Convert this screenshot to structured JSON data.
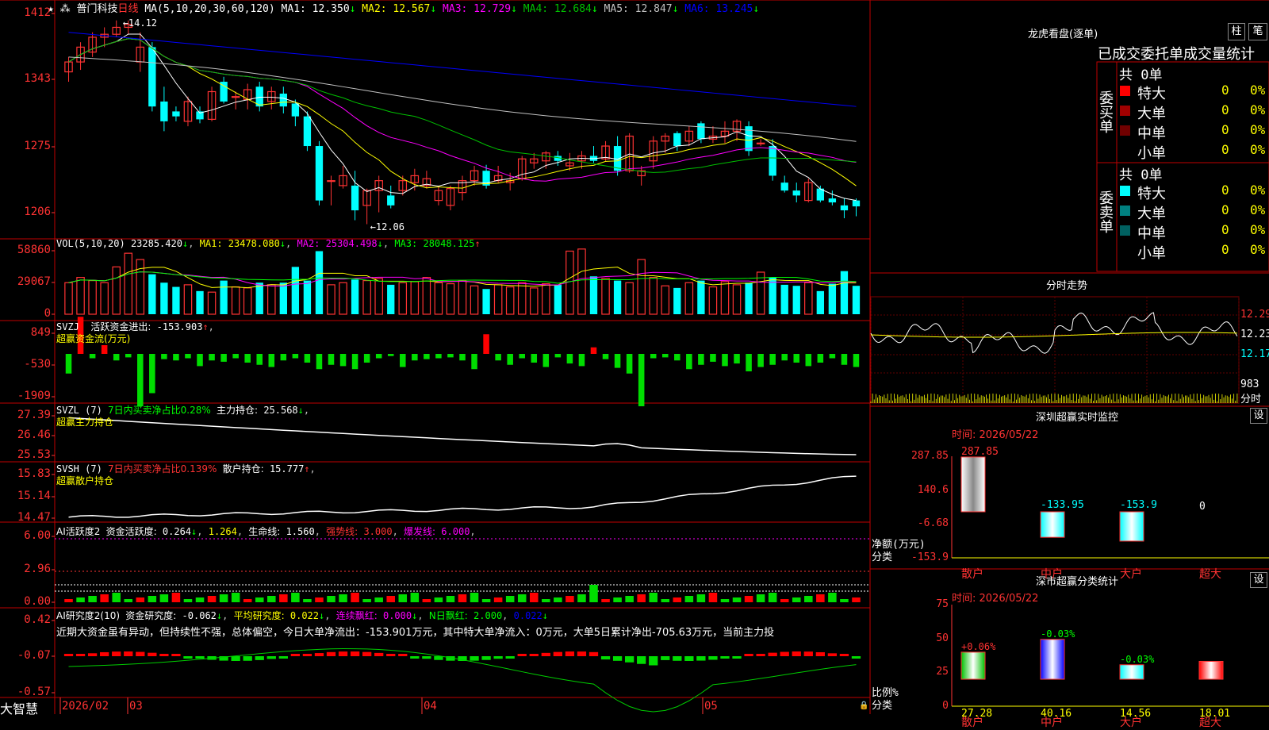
{
  "app": {
    "brand": "大智慧",
    "stock_name": "普门科技",
    "period": "日线"
  },
  "dates": {
    "x_labels": [
      "2026/02",
      "03",
      "04",
      "05"
    ]
  },
  "colors": {
    "up": "#ff3333",
    "down": "#00ffff",
    "grid": "#c00000",
    "ma1": "#ffffff",
    "ma2": "#ffff00",
    "ma3": "#ff00ff",
    "ma4": "#00c000",
    "ma5": "#c0c0c0",
    "ma6": "#0000ff"
  },
  "main_chart": {
    "header": "MA(5,10,20,30,60,120)",
    "ma_values": [
      {
        "label": "MA1:",
        "value": "12.350",
        "arrow": "↓",
        "color": "#ffffff"
      },
      {
        "label": "MA2:",
        "value": "12.567",
        "arrow": "↓",
        "color": "#ffff00"
      },
      {
        "label": "MA3:",
        "value": "12.729",
        "arrow": "↓",
        "color": "#ff00ff"
      },
      {
        "label": "MA4:",
        "value": "12.684",
        "arrow": "↓",
        "color": "#00c000"
      },
      {
        "label": "MA5:",
        "value": "12.847",
        "arrow": "↓",
        "color": "#c0c0c0"
      },
      {
        "label": "MA6:",
        "value": "13.245",
        "arrow": "↓",
        "color": "#0000ff"
      }
    ],
    "y_ticks": [
      "1412",
      "1343",
      "1275",
      "1206"
    ],
    "high_label": "14.12",
    "low_label": "12.06"
  },
  "chart_data": [
    {
      "type": "candlestick",
      "title": "普门科技 日线",
      "ylim": [
        12.0,
        14.15
      ],
      "candles": [
        {
          "o": 13.6,
          "h": 13.75,
          "l": 13.5,
          "c": 13.7
        },
        {
          "o": 13.7,
          "h": 13.9,
          "l": 13.62,
          "c": 13.85
        },
        {
          "o": 13.8,
          "h": 14.0,
          "l": 13.75,
          "c": 13.95
        },
        {
          "o": 13.95,
          "h": 14.05,
          "l": 13.85,
          "c": 13.98
        },
        {
          "o": 13.98,
          "h": 14.12,
          "l": 13.95,
          "c": 14.05
        },
        {
          "o": 14.05,
          "h": 14.12,
          "l": 13.98,
          "c": 14.08
        },
        {
          "o": 13.7,
          "h": 14.0,
          "l": 13.6,
          "c": 13.85
        },
        {
          "o": 13.85,
          "h": 13.9,
          "l": 13.2,
          "c": 13.25
        },
        {
          "o": 13.3,
          "h": 13.45,
          "l": 13.0,
          "c": 13.1
        },
        {
          "o": 13.2,
          "h": 13.25,
          "l": 13.1,
          "c": 13.15
        },
        {
          "o": 13.1,
          "h": 13.35,
          "l": 13.05,
          "c": 13.3
        },
        {
          "o": 13.2,
          "h": 13.25,
          "l": 13.08,
          "c": 13.12
        },
        {
          "o": 13.12,
          "h": 13.45,
          "l": 13.1,
          "c": 13.4
        },
        {
          "o": 13.5,
          "h": 13.55,
          "l": 13.28,
          "c": 13.3
        },
        {
          "o": 13.35,
          "h": 13.4,
          "l": 13.22,
          "c": 13.35
        },
        {
          "o": 13.32,
          "h": 13.48,
          "l": 13.22,
          "c": 13.42
        },
        {
          "o": 13.45,
          "h": 13.5,
          "l": 13.2,
          "c": 13.25
        },
        {
          "o": 13.3,
          "h": 13.45,
          "l": 13.22,
          "c": 13.4
        },
        {
          "o": 13.38,
          "h": 13.45,
          "l": 13.18,
          "c": 13.25
        },
        {
          "o": 13.28,
          "h": 13.32,
          "l": 13.05,
          "c": 13.15
        },
        {
          "o": 13.15,
          "h": 13.2,
          "l": 12.8,
          "c": 12.85
        },
        {
          "o": 12.85,
          "h": 12.9,
          "l": 12.25,
          "c": 12.3
        },
        {
          "o": 12.5,
          "h": 12.55,
          "l": 12.25,
          "c": 12.5
        },
        {
          "o": 12.45,
          "h": 12.65,
          "l": 12.42,
          "c": 12.55
        },
        {
          "o": 12.45,
          "h": 12.6,
          "l": 12.1,
          "c": 12.2
        },
        {
          "o": 12.25,
          "h": 12.42,
          "l": 12.06,
          "c": 12.4
        },
        {
          "o": 12.4,
          "h": 12.55,
          "l": 12.18,
          "c": 12.5
        },
        {
          "o": 12.35,
          "h": 12.45,
          "l": 12.22,
          "c": 12.25
        },
        {
          "o": 12.4,
          "h": 12.55,
          "l": 12.35,
          "c": 12.5
        },
        {
          "o": 12.48,
          "h": 12.62,
          "l": 12.4,
          "c": 12.55
        },
        {
          "o": 12.45,
          "h": 12.6,
          "l": 12.42,
          "c": 12.52
        },
        {
          "o": 12.3,
          "h": 12.45,
          "l": 12.25,
          "c": 12.4
        },
        {
          "o": 12.25,
          "h": 12.45,
          "l": 12.2,
          "c": 12.42
        },
        {
          "o": 12.38,
          "h": 12.55,
          "l": 12.3,
          "c": 12.5
        },
        {
          "o": 12.5,
          "h": 12.65,
          "l": 12.45,
          "c": 12.6
        },
        {
          "o": 12.6,
          "h": 12.66,
          "l": 12.42,
          "c": 12.45
        },
        {
          "o": 12.5,
          "h": 12.65,
          "l": 12.48,
          "c": 12.55
        },
        {
          "o": 12.48,
          "h": 12.58,
          "l": 12.4,
          "c": 12.5
        },
        {
          "o": 12.52,
          "h": 12.75,
          "l": 12.5,
          "c": 12.72
        },
        {
          "o": 12.68,
          "h": 12.78,
          "l": 12.62,
          "c": 12.72
        },
        {
          "o": 12.7,
          "h": 12.8,
          "l": 12.62,
          "c": 12.78
        },
        {
          "o": 12.75,
          "h": 12.8,
          "l": 12.65,
          "c": 12.7
        },
        {
          "o": 12.65,
          "h": 12.78,
          "l": 12.6,
          "c": 12.68
        },
        {
          "o": 12.7,
          "h": 12.8,
          "l": 12.62,
          "c": 12.75
        },
        {
          "o": 12.75,
          "h": 12.85,
          "l": 12.68,
          "c": 12.7
        },
        {
          "o": 12.72,
          "h": 12.9,
          "l": 12.7,
          "c": 12.85
        },
        {
          "o": 12.85,
          "h": 12.95,
          "l": 12.55,
          "c": 12.6
        },
        {
          "o": 12.6,
          "h": 12.98,
          "l": 12.58,
          "c": 12.95
        },
        {
          "o": 12.55,
          "h": 12.65,
          "l": 12.45,
          "c": 12.6
        },
        {
          "o": 12.7,
          "h": 12.95,
          "l": 12.62,
          "c": 12.9
        },
        {
          "o": 12.9,
          "h": 12.98,
          "l": 12.78,
          "c": 12.95
        },
        {
          "o": 12.98,
          "h": 13.0,
          "l": 12.8,
          "c": 12.85
        },
        {
          "o": 12.9,
          "h": 13.05,
          "l": 12.85,
          "c": 13.0
        },
        {
          "o": 13.08,
          "h": 13.1,
          "l": 12.88,
          "c": 12.92
        },
        {
          "o": 12.92,
          "h": 13.05,
          "l": 12.88,
          "c": 12.95
        },
        {
          "o": 12.95,
          "h": 13.1,
          "l": 12.88,
          "c": 13.0
        },
        {
          "o": 13.0,
          "h": 13.12,
          "l": 12.9,
          "c": 13.1
        },
        {
          "o": 13.05,
          "h": 13.1,
          "l": 12.75,
          "c": 12.8
        },
        {
          "o": 12.88,
          "h": 12.92,
          "l": 12.85,
          "c": 12.88
        },
        {
          "o": 12.85,
          "h": 12.92,
          "l": 12.5,
          "c": 12.55
        },
        {
          "o": 12.48,
          "h": 12.55,
          "l": 12.38,
          "c": 12.4
        },
        {
          "o": 12.4,
          "h": 12.48,
          "l": 12.28,
          "c": 12.35
        },
        {
          "o": 12.3,
          "h": 12.52,
          "l": 12.28,
          "c": 12.48
        },
        {
          "o": 12.42,
          "h": 12.45,
          "l": 12.28,
          "c": 12.3
        },
        {
          "o": 12.32,
          "h": 12.4,
          "l": 12.25,
          "c": 12.28
        },
        {
          "o": 12.25,
          "h": 12.32,
          "l": 12.12,
          "c": 12.2
        },
        {
          "o": 12.3,
          "h": 12.32,
          "l": 12.14,
          "c": 12.24
        }
      ]
    },
    {
      "type": "bar",
      "title": "VOL",
      "ylim": [
        0,
        58860
      ],
      "values": [
        30000,
        35000,
        32000,
        30000,
        45000,
        58000,
        52000,
        38000,
        30000,
        26000,
        28000,
        22000,
        21000,
        32000,
        26000,
        25000,
        30000,
        28000,
        30000,
        45000,
        32000,
        60000,
        28000,
        30000,
        33000,
        32000,
        34000,
        28000,
        30000,
        31000,
        35000,
        30000,
        29000,
        32000,
        27000,
        24000,
        28000,
        26000,
        30000,
        25000,
        29000,
        28000,
        60000,
        62000,
        36000,
        34000,
        32000,
        30000,
        52000,
        35000,
        27000,
        25000,
        30000,
        32000,
        26000,
        31000,
        28000,
        30000,
        40000,
        35000,
        28000,
        27000,
        30000,
        22000,
        29000,
        41000,
        27000
      ]
    }
  ],
  "vol_panel": {
    "header": "VOL(5,10,20)",
    "value": "23285.420",
    "ma1": "23478.080",
    "ma2": "25304.498",
    "ma3": "28048.125",
    "y_ticks": [
      "58860",
      "29067",
      "0"
    ]
  },
  "svzj_panel": {
    "title": "SVZJ",
    "label": "活跃资金进出:",
    "value": "-153.903",
    "sub": "超赢资金流(万元)",
    "y_ticks": [
      "849",
      "-530",
      "-1909"
    ],
    "bars": [
      -45,
      85,
      -10,
      20,
      -15,
      -8,
      -120,
      -90,
      -12,
      -15,
      -10,
      -28,
      -15,
      -18,
      -10,
      -20,
      -25,
      -30,
      -15,
      -10,
      -20,
      -35,
      -25,
      -28,
      -35,
      -20,
      -10,
      -5,
      -30,
      -15,
      -12,
      -10,
      -8,
      -15,
      -35,
      45,
      -15,
      -25,
      -10,
      -20,
      -30,
      -8,
      -22,
      -28,
      15,
      -12,
      -32,
      -45,
      -120,
      -10,
      -8,
      -15,
      -35,
      -25,
      -18,
      -28,
      -22,
      -40,
      -30,
      -25,
      -15,
      -20,
      -28,
      -20,
      -10,
      -25,
      -30
    ]
  },
  "svzl_panel": {
    "title": "SVZL (7)",
    "label": "7日内买卖净占比0.28%",
    "label2": "主力持仓:",
    "value": "25.568",
    "sub": "超赢主力持仓",
    "y_ticks": [
      "27.39",
      "26.46",
      "25.53"
    ]
  },
  "svsh_panel": {
    "title": "SVSH (7)",
    "label": "7日内买卖净占比0.139%",
    "label2": "散户持仓:",
    "value": "15.777",
    "sub": "超赢散户持仓",
    "y_ticks": [
      "15.83",
      "15.14",
      "14.47"
    ]
  },
  "ai_active_panel": {
    "title": "AI活跃度2",
    "label1": "资金活跃度:",
    "value1": "0.264",
    "value2": "1.264",
    "label3": "生命线:",
    "value3": "1.560",
    "label4": "强势线:",
    "value4": "3.000",
    "label5": "爆发线:",
    "value5": "6.000",
    "y_ticks": [
      "6.00",
      "2.96",
      "0.00"
    ]
  },
  "ai_research_panel": {
    "title": "AI研究度2(10)",
    "label1": "资金研究度:",
    "value1": "-0.062",
    "label2": "平均研究度:",
    "value2": "0.022",
    "label3": "连续飘红:",
    "value3": "0.000",
    "label4": "N日飘红:",
    "value4": "2.000",
    "value5": "0.022",
    "comment": "近期大资金虽有异动，但持续性不强，总体偏空，今日大单净流出：-153.901万元，其中特大单净流入：0万元，大单5日累计净出-705.63万元，当前主力投",
    "y_ticks": [
      "0.42",
      "-0.07",
      "-0.57"
    ]
  },
  "right_panel": {
    "dragon": {
      "title": "龙虎看盘(逐单)",
      "btn_bar": "柱",
      "btn_pen": "笔",
      "tabs": [
        "已成交",
        "委托单",
        "成交量统计"
      ],
      "buy": {
        "label": "委买单",
        "total": "共 0单",
        "rows": [
          {
            "name": "特大",
            "count": "0",
            "pct": "0%",
            "color": "#ff0000"
          },
          {
            "name": "大单",
            "count": "0",
            "pct": "0%",
            "color": "#a00000"
          },
          {
            "name": "中单",
            "count": "0",
            "pct": "0%",
            "color": "#700000"
          },
          {
            "name": "小单",
            "count": "0",
            "pct": "0%",
            "color": ""
          }
        ]
      },
      "sell": {
        "label": "委卖单",
        "total": "共 0单",
        "rows": [
          {
            "name": "特大",
            "count": "0",
            "pct": "0%",
            "color": "#00ffff"
          },
          {
            "name": "大单",
            "count": "0",
            "pct": "0%",
            "color": "#008080"
          },
          {
            "name": "中单",
            "count": "0",
            "pct": "0%",
            "color": "#006060"
          },
          {
            "name": "小单",
            "count": "0",
            "pct": "0%",
            "color": ""
          }
        ]
      }
    },
    "intraday": {
      "title": "分时走势",
      "y_ticks": [
        "12.29",
        "12.23",
        "12.17"
      ],
      "vol_tick": "983",
      "vol_label": "分时"
    },
    "szmon": {
      "title": "深圳超赢实时监控",
      "btn": "设",
      "time": "时间: 2026/05/22",
      "y_ticks": [
        "287.85",
        "140.6",
        "-6.68",
        "-153.9"
      ],
      "ylabel1": "净额(万元)",
      "ylabel2": "分类",
      "categories": [
        "散户",
        "中户",
        "大户",
        "超大"
      ],
      "values": [
        287.85,
        -133.95,
        -153.9,
        0
      ],
      "value_labels": [
        "287.85",
        "-133.95",
        "-153.9",
        "0"
      ]
    },
    "szclass": {
      "title": "深市超赢分类统计",
      "btn": "设",
      "time": "时间: 2026/05/22",
      "y_ticks": [
        "75",
        "50",
        "25",
        "0"
      ],
      "ylabel1": "比例%",
      "ylabel2": "分类",
      "categories": [
        "散户",
        "中户",
        "大户",
        "超大"
      ],
      "values": [
        27.28,
        40.16,
        14.56,
        18.01
      ],
      "value_labels": [
        "27.28",
        "40.16",
        "14.56",
        "18.01"
      ],
      "changes": [
        "+0.06%",
        "-0.03%",
        "-0.03%",
        ""
      ]
    }
  }
}
